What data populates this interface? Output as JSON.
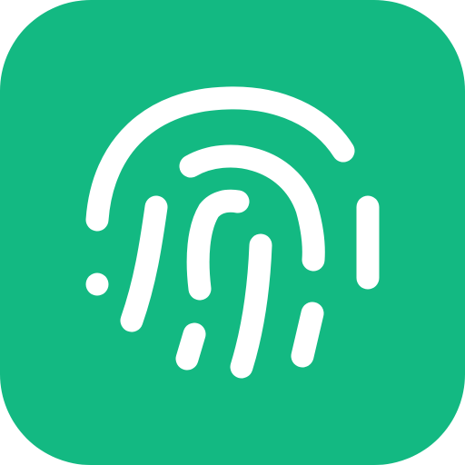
{
  "app_icon": {
    "icon": "fingerprint-icon",
    "background_color": "#13B982",
    "glyph_color": "#FFFFFF"
  }
}
